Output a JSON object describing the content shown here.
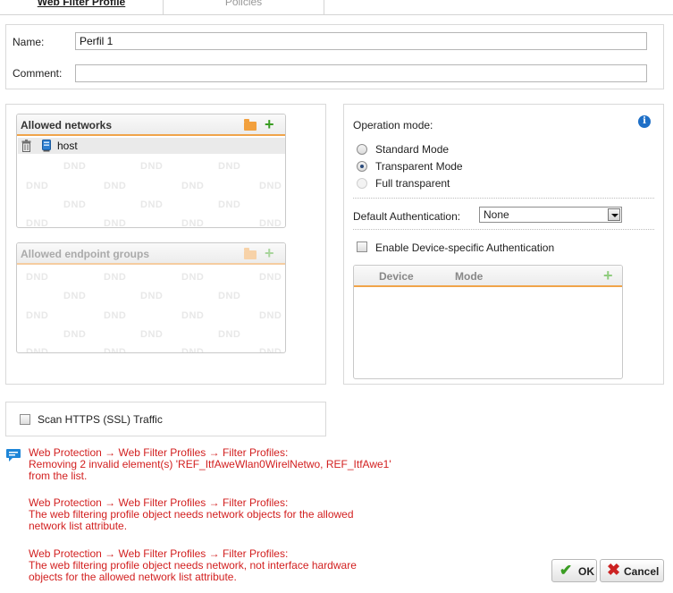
{
  "tabs": [
    {
      "label": "Web Filter Profile",
      "active": true
    },
    {
      "label": "Policies",
      "active": false
    }
  ],
  "form": {
    "name_label": "Name:",
    "name_value": "Perfil 1",
    "comment_label": "Comment:",
    "comment_value": ""
  },
  "allowed_networks": {
    "title": "Allowed networks",
    "items": [
      {
        "label": "host"
      }
    ],
    "placeholder": "DND"
  },
  "allowed_endpoint_groups": {
    "title": "Allowed endpoint groups",
    "placeholder": "DND"
  },
  "operation": {
    "label": "Operation mode:",
    "modes": [
      {
        "label": "Standard Mode",
        "checked": false,
        "disabled": false
      },
      {
        "label": "Transparent Mode",
        "checked": true,
        "disabled": false
      },
      {
        "label": "Full transparent",
        "checked": false,
        "disabled": true
      }
    ]
  },
  "default_auth": {
    "label": "Default Authentication:",
    "value": "None"
  },
  "device_auth": {
    "label": "Enable Device-specific Authentication",
    "checked": false,
    "columns": [
      "Device",
      "Mode"
    ]
  },
  "scan_https": {
    "label": "Scan HTTPS (SSL) Traffic",
    "checked": false
  },
  "messages": [
    "Web Protection → Web Filter Profiles → Filter Profiles:\nRemoving 2 invalid element(s) 'REF_ItfAweWlan0WirelNetwo, REF_ItfAwe1'\nfrom the list.",
    "Web Protection → Web Filter Profiles → Filter Profiles:\nThe web filtering profile object needs network objects for the allowed\nnetwork list attribute.",
    "Web Protection → Web Filter Profiles → Filter Profiles:\nThe web filtering profile object needs network, not interface hardware\nobjects for the allowed network list attribute."
  ],
  "buttons": {
    "ok": "OK",
    "cancel": "Cancel"
  },
  "colors": {
    "accent_orange": "#f0a44a",
    "add_green": "#3a9d23",
    "error_red": "#d21f1f",
    "info_blue": "#1e6fc7"
  }
}
